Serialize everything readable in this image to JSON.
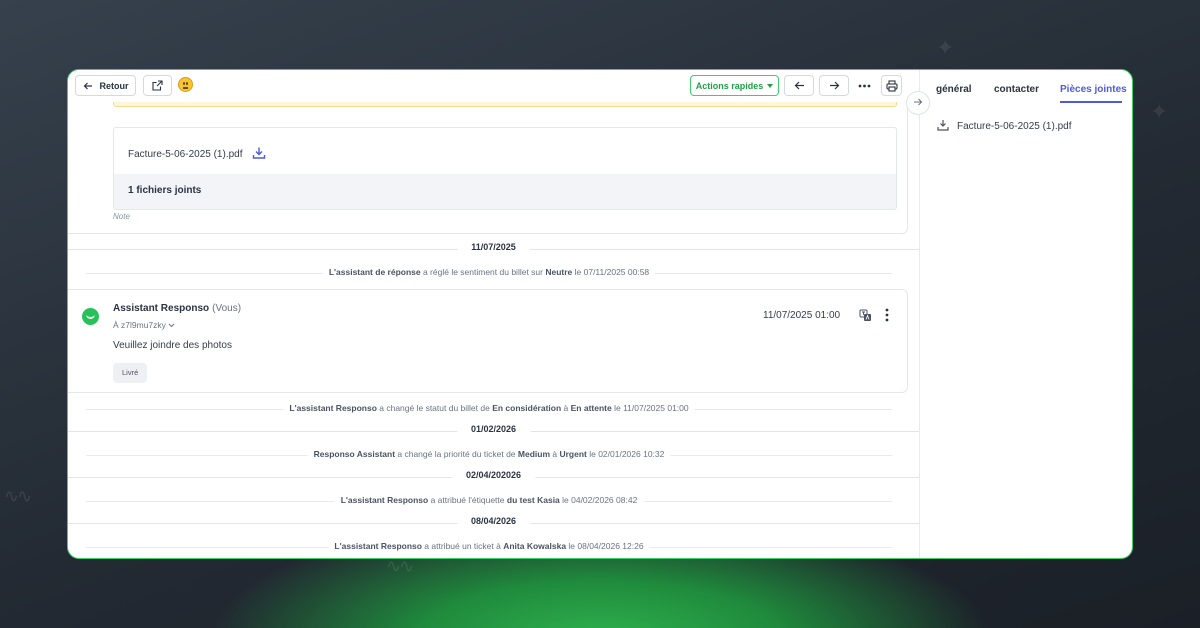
{
  "toolbar": {
    "back_label": "Retour",
    "quick_actions_label": "Actions rapides"
  },
  "note": {
    "attachment_name": "Facture-5-06-2025 (1).pdf",
    "attachment_count": "1 fichiers joints",
    "label": "Note"
  },
  "timeline": {
    "date1": "11/07/2025",
    "event1": {
      "actor": "L'assistant de réponse",
      "text1": " a réglé le sentiment du billet sur ",
      "value": "Neutre",
      "text2": " le 07/11/2025 00:58"
    },
    "message": {
      "author": "Assistant Responso",
      "author_suffix": "(Vous)",
      "recipient": "À z7l9mu7zky",
      "body": "Veuillez joindre des photos",
      "tag": "Livré",
      "timestamp": "11/07/2025 01:00"
    },
    "event2": {
      "actor": "L'assistant Responso",
      "text1": " a changé le statut du billet de ",
      "from": "En considération",
      "text2": " à ",
      "to": "En attente",
      "text3": " le 11/07/2025 01:00"
    },
    "date2": "01/02/2026",
    "event3": {
      "actor": "Responso Assistant",
      "text1": " a changé la priorité du ticket de ",
      "from": "Medium",
      "text2": " à ",
      "to": "Urgent",
      "text3": " le 02/01/2026 10:32"
    },
    "date3": "02/04/202026",
    "event4": {
      "actor": "L'assistant Responso",
      "text1": " a attribué l'étiquette ",
      "value": "du test Kasia",
      "text2": " le 04/02/2026 08:42"
    },
    "date4": "08/04/2026",
    "event5": {
      "actor": "L'assistant Responso",
      "text1": " a attribué un ticket à ",
      "value": "Anita Kowalska",
      "text2": " le 08/04/2026 12:26"
    }
  },
  "sidebar": {
    "tabs": [
      "général",
      "contacter",
      "Pièces jointes"
    ],
    "active_tab": "Pièces jointes",
    "files": [
      "Facture-5-06-2025 (1).pdf"
    ]
  },
  "colors": {
    "accent_green": "#3ecf6a",
    "active_tab": "#4f5bd5",
    "background": "#232a33"
  }
}
